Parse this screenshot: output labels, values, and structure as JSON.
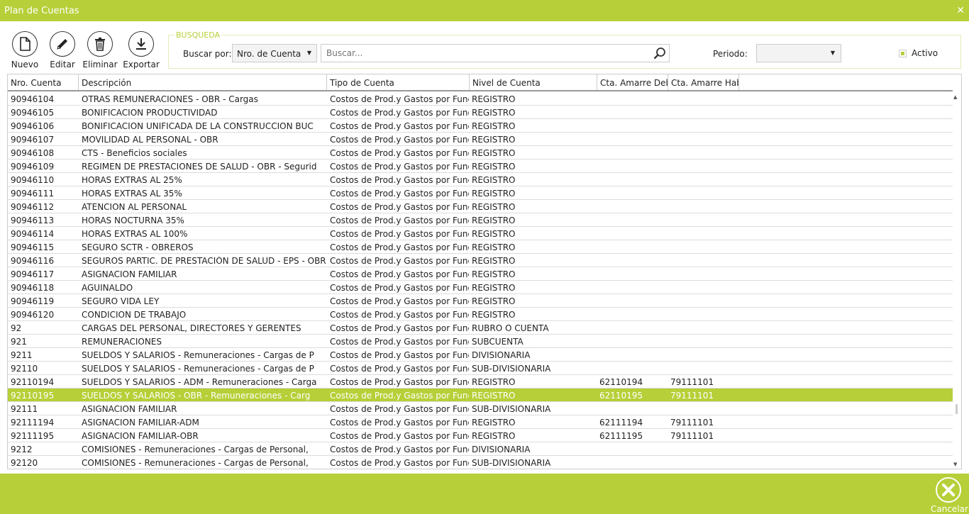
{
  "window": {
    "title": "Plan de Cuentas",
    "close_glyph": "✕"
  },
  "toolbar": {
    "nuevo": "Nuevo",
    "editar": "Editar",
    "eliminar": "Eliminar",
    "exportar": "Exportar"
  },
  "search": {
    "group_label": "BUSQUEDA",
    "buscar_por_label": "Buscar por:",
    "buscar_por_value": "Nro. de Cuenta",
    "placeholder": "Buscar...",
    "periodo_label": "Periodo:",
    "periodo_value": "",
    "activo_label": "Activo",
    "activo_checked": true
  },
  "table": {
    "columns": [
      "Nro. Cuenta",
      "Descripción",
      "Tipo de Cuenta",
      "Nivel de Cuenta",
      "Cta. Amarre Deb",
      "Cta. Amarre Hab"
    ],
    "selected_index": 22,
    "rows": [
      [
        "90946104",
        "OTRAS REMUNERACIONES - OBR - Cargas",
        "Costos de Prod.y Gastos por Función",
        "REGISTRO",
        "",
        ""
      ],
      [
        "90946105",
        "BONIFICACION PRODUCTIVIDAD",
        "Costos de Prod.y Gastos por Función",
        "REGISTRO",
        "",
        ""
      ],
      [
        "90946106",
        "BONIFICACION UNIFICADA DE LA CONSTRUCCION BUC",
        "Costos de Prod.y Gastos por Función",
        "REGISTRO",
        "",
        ""
      ],
      [
        "90946107",
        "MOVILIDAD AL PERSONAL - OBR",
        "Costos de Prod.y Gastos por Función",
        "REGISTRO",
        "",
        ""
      ],
      [
        "90946108",
        "CTS -  Beneficios sociales",
        "Costos de Prod.y Gastos por Función",
        "REGISTRO",
        "",
        ""
      ],
      [
        "90946109",
        "REGIMEN DE PRESTACIONES DE SALUD  - OBR - Segurid",
        "Costos de Prod.y Gastos por Función",
        "REGISTRO",
        "",
        ""
      ],
      [
        "90946110",
        "HORAS EXTRAS AL 25%",
        "Costos de Prod.y Gastos por Función",
        "REGISTRO",
        "",
        ""
      ],
      [
        "90946111",
        "HORAS EXTRAS AL 35%",
        "Costos de Prod.y Gastos por Función",
        "REGISTRO",
        "",
        ""
      ],
      [
        "90946112",
        "ATENCION AL PERSONAL",
        "Costos de Prod.y Gastos por Función",
        "REGISTRO",
        "",
        ""
      ],
      [
        "90946113",
        "HORAS NOCTURNA  35%",
        "Costos de Prod.y Gastos por Función",
        "REGISTRO",
        "",
        ""
      ],
      [
        "90946114",
        "HORAS EXTRAS AL 100%",
        "Costos de Prod.y Gastos por Función",
        "REGISTRO",
        "",
        ""
      ],
      [
        "90946115",
        "SEGURO SCTR - OBREROS",
        "Costos de Prod.y Gastos por Función",
        "REGISTRO",
        "",
        ""
      ],
      [
        "90946116",
        "SEGUROS PARTIC. DE PRESTACIÓN DE SALUD - EPS - OBR",
        "Costos de Prod.y Gastos por Función",
        "REGISTRO",
        "",
        ""
      ],
      [
        "90946117",
        "ASIGNACION FAMILIAR",
        "Costos de Prod.y Gastos por Función",
        "REGISTRO",
        "",
        ""
      ],
      [
        "90946118",
        "AGUINALDO",
        "Costos de Prod.y Gastos por Función",
        "REGISTRO",
        "",
        ""
      ],
      [
        "90946119",
        "SEGURO VIDA LEY",
        "Costos de Prod.y Gastos por Función",
        "REGISTRO",
        "",
        ""
      ],
      [
        "90946120",
        "CONDICION DE TRABAJO",
        "Costos de Prod.y Gastos por Función",
        "REGISTRO",
        "",
        ""
      ],
      [
        "92",
        "CARGAS DEL PERSONAL, DIRECTORES Y GERENTES",
        "Costos de Prod.y Gastos por Función",
        "RUBRO O CUENTA",
        "",
        ""
      ],
      [
        "921",
        "REMUNERACIONES",
        "Costos de Prod.y Gastos por Función",
        "SUBCUENTA",
        "",
        ""
      ],
      [
        "9211",
        "SUELDOS Y SALARIOS - Remuneraciones  - Cargas de P",
        "Costos de Prod.y Gastos por Función",
        "DIVISIONARIA",
        "",
        ""
      ],
      [
        "92110",
        "SUELDOS Y SALARIOS - Remuneraciones  - Cargas de P",
        "Costos de Prod.y Gastos por Función",
        "SUB-DIVISIONARIA",
        "",
        ""
      ],
      [
        "92110194",
        "SUELDOS Y SALARIOS - ADM - Remuneraciones  - Carga",
        "Costos de Prod.y Gastos por Función",
        "REGISTRO",
        "62110194",
        "79111101"
      ],
      [
        "92110195",
        "SUELDOS Y SALARIOS - OBR - Remuneraciones  - Carg",
        "Costos de Prod.y Gastos por Función",
        "REGISTRO",
        "62110195",
        "79111101"
      ],
      [
        "92111",
        "ASIGNACION FAMILIAR",
        "Costos de Prod.y Gastos por Función",
        "SUB-DIVISIONARIA",
        "",
        ""
      ],
      [
        "92111194",
        "ASIGNACION FAMILIAR-ADM",
        "Costos de Prod.y Gastos por Función",
        "REGISTRO",
        "62111194",
        "79111101"
      ],
      [
        "92111195",
        "ASIGNACION FAMILIAR-OBR",
        "Costos de Prod.y Gastos por Función",
        "REGISTRO",
        "62111195",
        "79111101"
      ],
      [
        "9212",
        "COMISIONES - Remuneraciones  - Cargas de Personal,",
        "Costos de Prod.y Gastos por Función",
        "DIVISIONARIA",
        "",
        ""
      ],
      [
        "92120",
        "COMISIONES - Remuneraciones  - Cargas de Personal,",
        "Costos de Prod.y Gastos por Función",
        "SUB-DIVISIONARIA",
        "",
        ""
      ]
    ]
  },
  "footer": {
    "cancel_label": "Cancelar"
  },
  "colors": {
    "accent": "#b7cf38",
    "selected_row": "#b7cf38"
  }
}
